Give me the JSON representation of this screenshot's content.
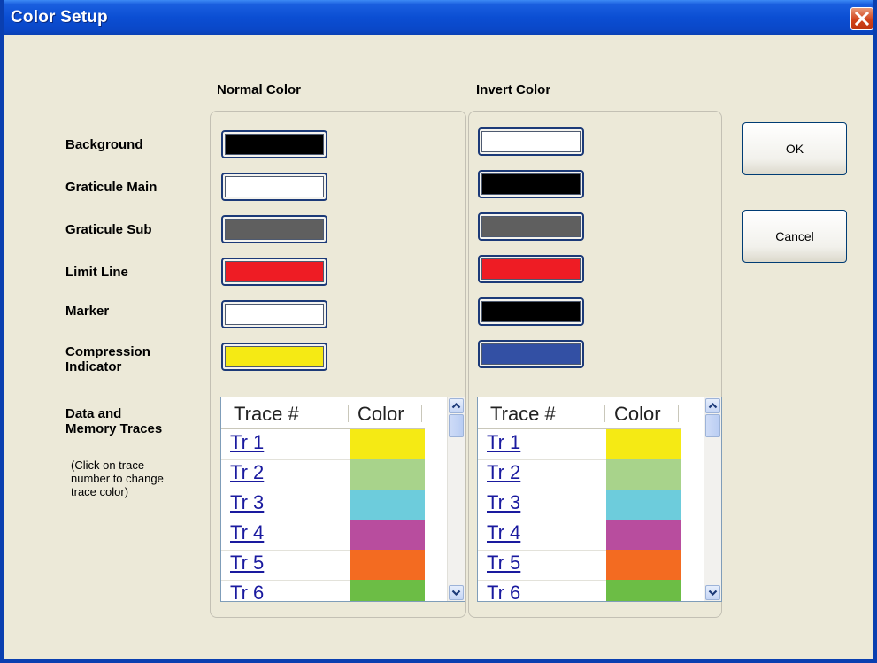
{
  "window": {
    "title": "Color Setup"
  },
  "headers": {
    "normal": "Normal Color",
    "invert": "Invert Color"
  },
  "labels": {
    "background": "Background",
    "graticule_main": "Graticule Main",
    "graticule_sub": "Graticule Sub",
    "limit_line": "Limit Line",
    "marker": "Marker",
    "compression_1": "Compression",
    "compression_2": "Indicator",
    "traces_1": "Data and",
    "traces_2": "Memory Traces"
  },
  "note": {
    "l1": "(Click on trace",
    "l2": "number to change",
    "l3": "trace color)"
  },
  "colors": {
    "normal": {
      "background": "#000000",
      "graticule_main": "#ffffff",
      "graticule_sub": "#5f5f5f",
      "limit_line": "#ee1c24",
      "marker": "#ffffff",
      "compression": "#f5ea14"
    },
    "invert": {
      "background": "#ffffff",
      "graticule_main": "#000000",
      "graticule_sub": "#5f5f5f",
      "limit_line": "#ee1c24",
      "marker": "#000000",
      "compression": "#3350a4"
    }
  },
  "buttons": {
    "ok": "OK",
    "cancel": "Cancel"
  },
  "trace_table": {
    "col_trace": "Trace #",
    "col_color": "Color",
    "rows": [
      {
        "label": "Tr 1",
        "color": "#f5ea14"
      },
      {
        "label": "Tr 2",
        "color": "#a8d38b"
      },
      {
        "label": "Tr 3",
        "color": "#6dccdc"
      },
      {
        "label": "Tr 4",
        "color": "#b84d9e"
      },
      {
        "label": "Tr 5",
        "color": "#f36b21"
      },
      {
        "label": "Tr 6",
        "color": "#6cbd45"
      }
    ]
  },
  "icons": {
    "close": "close-icon",
    "scroll_up": "chevron-up-icon",
    "scroll_down": "chevron-down-icon"
  }
}
